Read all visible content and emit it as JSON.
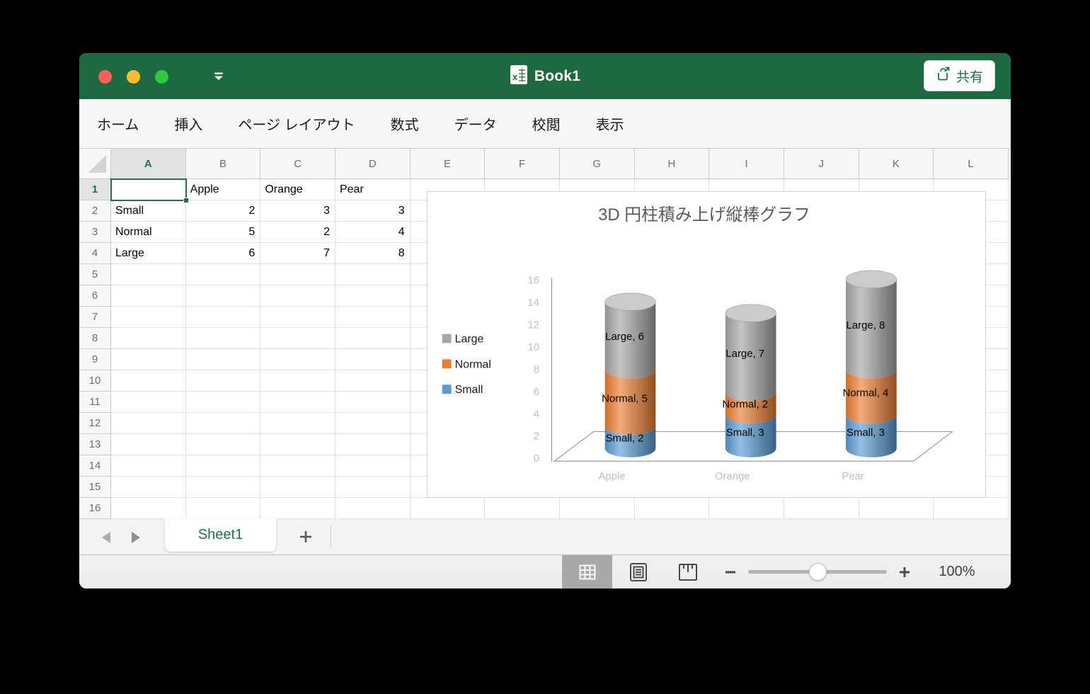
{
  "window": {
    "title": "Book1"
  },
  "titlebar": {
    "traffic_lights": [
      "close",
      "minimize",
      "zoom"
    ]
  },
  "menubar": {
    "tabs": [
      "ホーム",
      "挿入",
      "ページ レイアウト",
      "数式",
      "データ",
      "校閲",
      "表示"
    ],
    "share_label": "共有"
  },
  "grid": {
    "columns": [
      "A",
      "B",
      "C",
      "D",
      "E",
      "F",
      "G",
      "H",
      "I",
      "J",
      "K",
      "L"
    ],
    "row_numbers": [
      1,
      2,
      3,
      4,
      5,
      6,
      7,
      8,
      9,
      10,
      11,
      12,
      13,
      14,
      15,
      16
    ],
    "selected_cell": "A1",
    "selected_column": "A",
    "selected_row": 1,
    "cells": {
      "B1": "Apple",
      "C1": "Orange",
      "D1": "Pear",
      "A2": "Small",
      "B2": 2,
      "C2": 3,
      "D2": 3,
      "A3": "Normal",
      "B3": 5,
      "C3": 2,
      "D3": 4,
      "A4": "Large",
      "B4": 6,
      "C4": 7,
      "D4": 8
    }
  },
  "sheet_bar": {
    "active_tab": "Sheet1",
    "add_label": "+"
  },
  "status_bar": {
    "views": [
      "normal",
      "page-layout",
      "page-break"
    ],
    "active_view": "normal",
    "zoom_percent": "100%"
  },
  "chart_data": {
    "type": "bar",
    "subtype": "3d-cylinder-stacked-column",
    "title": "3D 円柱積み上げ縦棒グラフ",
    "categories": [
      "Apple",
      "Orange",
      "Pear"
    ],
    "series": [
      {
        "name": "Small",
        "color": "#5B9BD5",
        "values": [
          2,
          3,
          3
        ]
      },
      {
        "name": "Normal",
        "color": "#ED7D31",
        "values": [
          5,
          2,
          4
        ]
      },
      {
        "name": "Large",
        "color": "#A6A6A6",
        "values": [
          6,
          7,
          8
        ]
      }
    ],
    "ylim": [
      0,
      16
    ],
    "ytick_step": 2,
    "legend": {
      "position": "left",
      "order": [
        "Large",
        "Normal",
        "Small"
      ]
    },
    "data_labels_format": "{series}, {value}",
    "axis_text_color": "#BFBFBF",
    "title_color": "#595959"
  }
}
